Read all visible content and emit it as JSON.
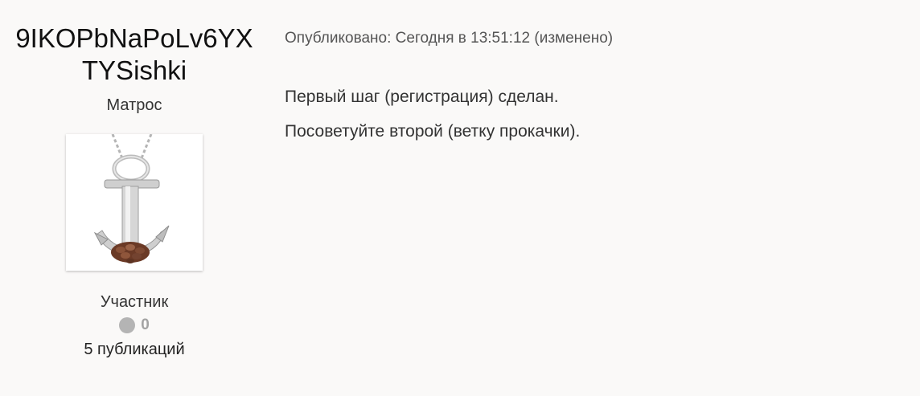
{
  "author": {
    "name": "9IKOPbNaPoLv6YXTYSishki",
    "title": "Матрос",
    "group": "Участник",
    "reputation": "0",
    "posts": "5 публикаций",
    "avatar_icon": "anchor-pendant-icon"
  },
  "post": {
    "meta": "Опубликовано: Сегодня в 13:51:12 (изменено)",
    "lines": [
      "Первый шаг (регистрация) сделан.",
      "Посоветуйте второй (ветку прокачки)."
    ]
  },
  "colors": {
    "background": "#faf9f8",
    "reputation_gray": "#b4b4b4"
  }
}
